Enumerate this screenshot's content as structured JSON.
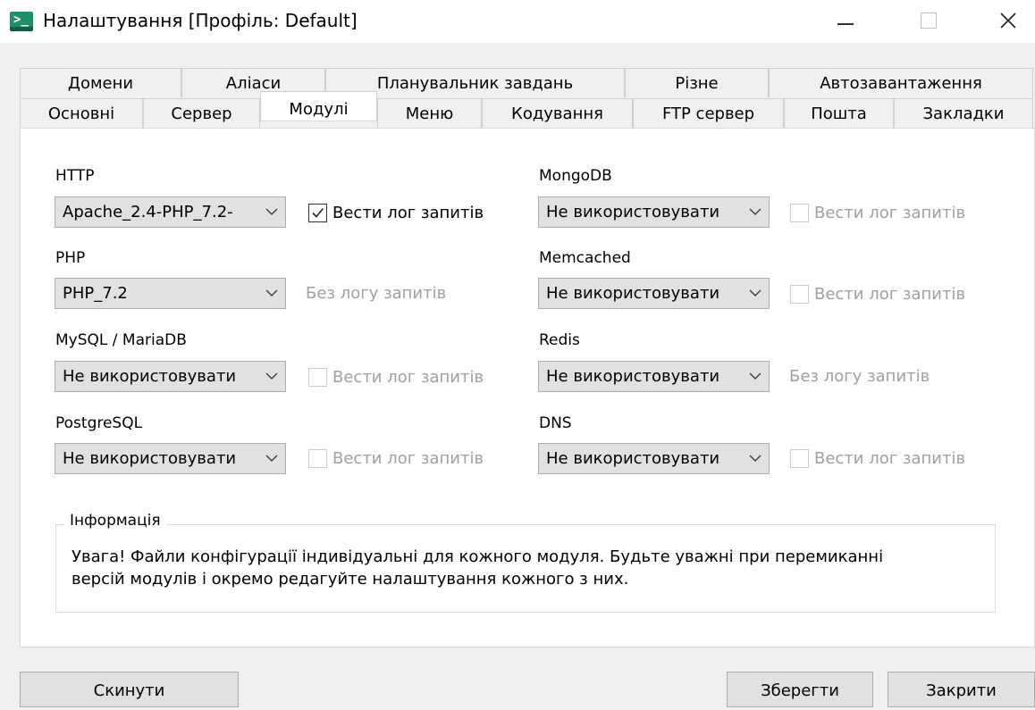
{
  "window": {
    "title": "Налаштування [Профіль: Default]",
    "app_icon": "terminal-icon"
  },
  "tabs": {
    "row1": [
      "Домени",
      "Аліаси",
      "Планувальник завдань",
      "Різне",
      "Автозавантаження"
    ],
    "row2": [
      "Основні",
      "Сервер",
      "Модулі",
      "Меню",
      "Кодування",
      "FTP сервер",
      "Пошта",
      "Закладки"
    ],
    "active": "Модулі"
  },
  "modules": {
    "http": {
      "label": "HTTP",
      "value": "Apache_2.4-PHP_7.2-",
      "log_label": "Вести лог запитів",
      "log_checked": true
    },
    "php": {
      "label": "PHP",
      "value": "PHP_7.2",
      "no_log_text": "Без логу запитів"
    },
    "mysql": {
      "label": "MySQL / MariaDB",
      "value": "Не використовувати",
      "log_label": "Вести лог запитів",
      "log_checked": false
    },
    "postgresql": {
      "label": "PostgreSQL",
      "value": "Не використовувати",
      "log_label": "Вести лог запитів",
      "log_checked": false
    },
    "mongodb": {
      "label": "MongoDB",
      "value": "Не використовувати",
      "log_label": "Вести лог запитів",
      "log_checked": false
    },
    "memcached": {
      "label": "Memcached",
      "value": "Не використовувати",
      "log_label": "Вести лог запитів",
      "log_checked": false
    },
    "redis": {
      "label": "Redis",
      "value": "Не використовувати",
      "no_log_text": "Без логу запитів"
    },
    "dns": {
      "label": "DNS",
      "value": "Не використовувати",
      "log_label": "Вести лог запитів",
      "log_checked": false
    }
  },
  "info": {
    "title": "Інформація",
    "line1": "Увага! Файли конфігурації індивідуальні для кожного модуля. Будьте уважні при перемиканні",
    "line2": "версій модулів і окремо редагуйте налаштування кожного з них."
  },
  "buttons": {
    "reset": "Скинути",
    "save": "Зберегти",
    "close": "Закрити"
  },
  "colors": {
    "panel": "#ffffff",
    "window_bg": "#f0f0f0",
    "control": "#e1e1e1",
    "disabled_text": "#a0a0a0"
  }
}
